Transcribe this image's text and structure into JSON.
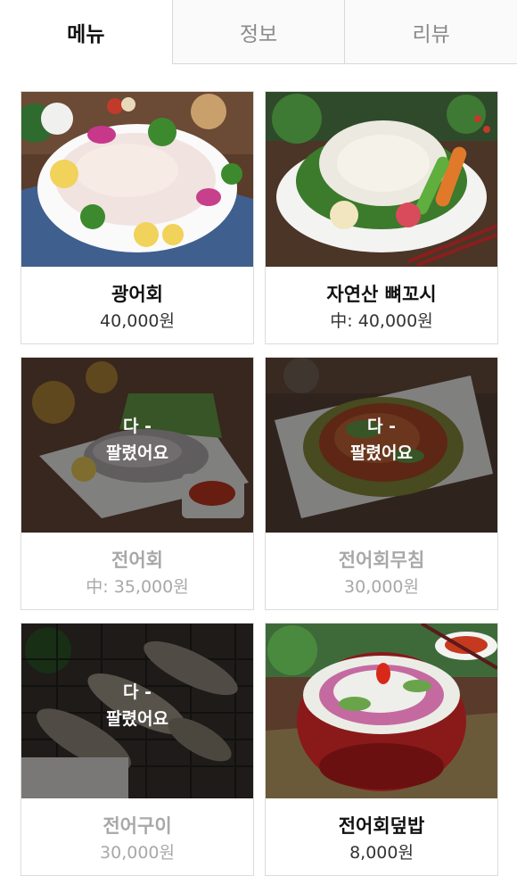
{
  "tabs": [
    {
      "label": "메뉴"
    },
    {
      "label": "정보"
    },
    {
      "label": "리뷰"
    }
  ],
  "menu_items": [
    {
      "name": "광어회",
      "price": "40,000원",
      "sold_out_label": ""
    },
    {
      "name": "자연산 뼈꼬시",
      "price": "中: 40,000원",
      "sold_out_label": ""
    },
    {
      "name": "전어회",
      "price": "中: 35,000원",
      "sold_out_label": "다 -\n팔렸어요"
    },
    {
      "name": "전어회무침",
      "price": "30,000원",
      "sold_out_label": "다 -\n팔렸어요"
    },
    {
      "name": "전어구이",
      "price": "30,000원",
      "sold_out_label": "다 -\n팔렸어요"
    },
    {
      "name": "전어회덮밥",
      "price": "8,000원",
      "sold_out_label": ""
    }
  ],
  "colors": {
    "active_tab_text": "#111111",
    "inactive_tab_text": "#8a8a8a",
    "sold_out_text": "#a8a8a8",
    "overlay": "rgba(0,0,0,0.48)"
  }
}
